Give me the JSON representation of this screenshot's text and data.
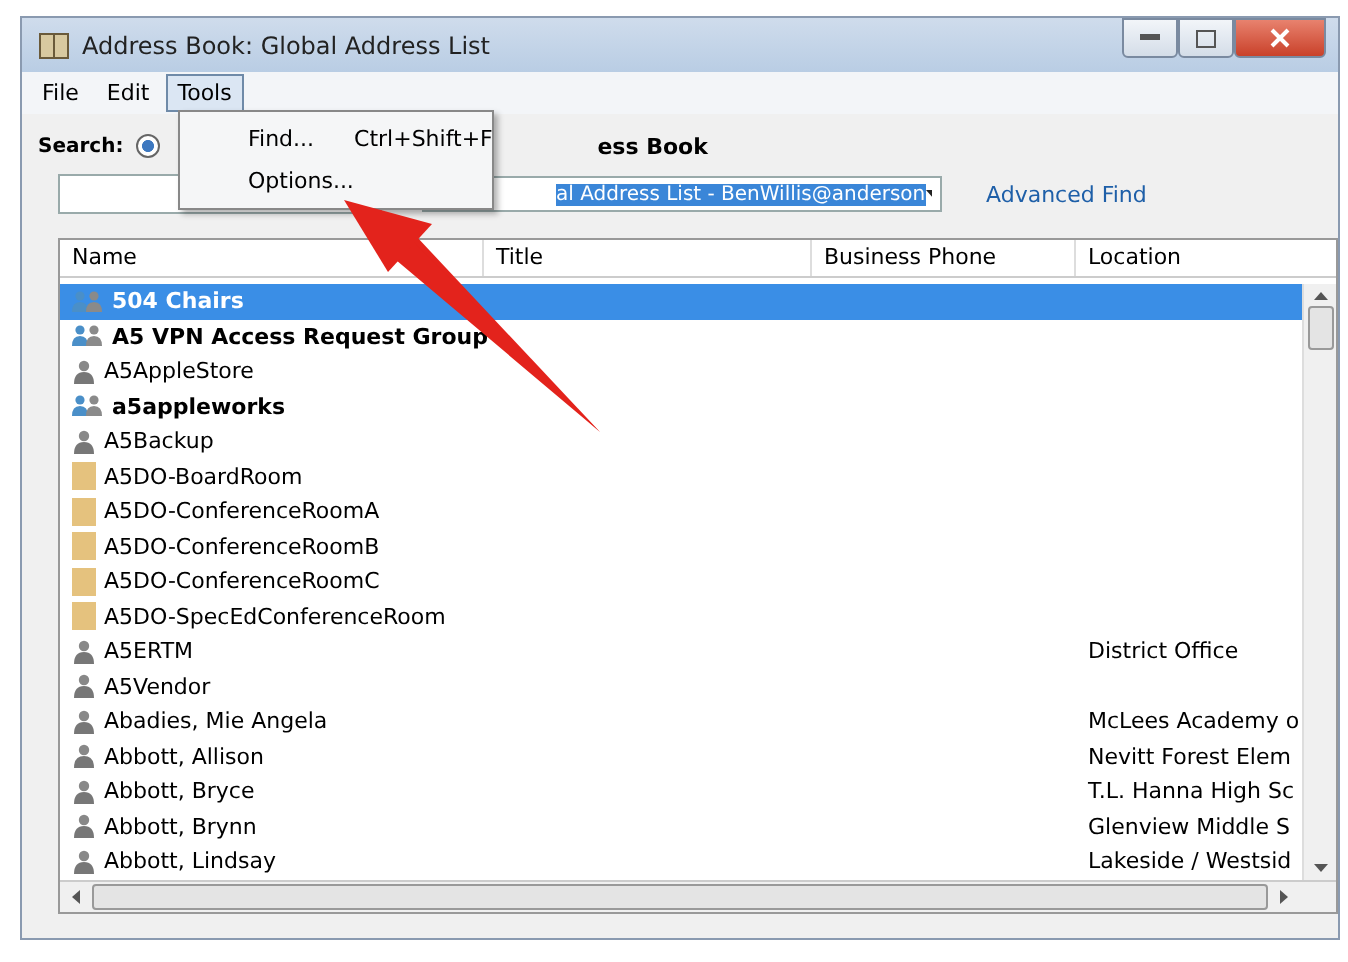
{
  "window": {
    "title": "Address Book: Global Address List"
  },
  "menu": [
    {
      "label": "File",
      "selected": false
    },
    {
      "label": "Edit",
      "selected": false
    },
    {
      "label": "Tools",
      "selected": true
    }
  ],
  "tools_menu": [
    {
      "label": "Find...",
      "shortcut": "Ctrl+Shift+F"
    },
    {
      "label": "Options..."
    }
  ],
  "search": {
    "label": "Search:",
    "option_selected": true,
    "option_label": "ess Book",
    "address_book": "al Address List - BenWillis@anderson",
    "advanced_find": "Advanced Find"
  },
  "table": {
    "columns": [
      "Name",
      "Title",
      "Business Phone",
      "Location"
    ],
    "rows": [
      {
        "kind": "group",
        "name": "504 Chairs",
        "selected": true
      },
      {
        "kind": "group",
        "name": "A5 VPN Access Request Group",
        "selected": false
      },
      {
        "kind": "person",
        "name": "A5AppleStore",
        "selected": false
      },
      {
        "kind": "group",
        "name": "a5appleworks",
        "selected": false
      },
      {
        "kind": "person",
        "name": "A5Backup",
        "selected": false
      },
      {
        "kind": "room",
        "name": "A5DO-BoardRoom",
        "selected": false
      },
      {
        "kind": "room",
        "name": "A5DO-ConferenceRoomA",
        "selected": false
      },
      {
        "kind": "room",
        "name": "A5DO-ConferenceRoomB",
        "selected": false
      },
      {
        "kind": "room",
        "name": "A5DO-ConferenceRoomC",
        "selected": false
      },
      {
        "kind": "room",
        "name": "A5DO-SpecEdConferenceRoom",
        "selected": false
      },
      {
        "kind": "person",
        "name": "A5ERTM",
        "location": "District Office",
        "selected": false
      },
      {
        "kind": "person",
        "name": "A5Vendor",
        "selected": false
      },
      {
        "kind": "person",
        "name": "Abadies, Mie Angela",
        "location": "McLees Academy o",
        "selected": false
      },
      {
        "kind": "person",
        "name": "Abbott, Allison",
        "location": "Nevitt Forest Elem",
        "selected": false
      },
      {
        "kind": "person",
        "name": "Abbott, Bryce",
        "location": "T.L. Hanna High Sc",
        "selected": false
      },
      {
        "kind": "person",
        "name": "Abbott, Brynn",
        "location": "Glenview Middle S",
        "selected": false
      },
      {
        "kind": "person",
        "name": "Abbott, Lindsay",
        "location": "Lakeside / Westsid",
        "selected": false
      }
    ]
  }
}
